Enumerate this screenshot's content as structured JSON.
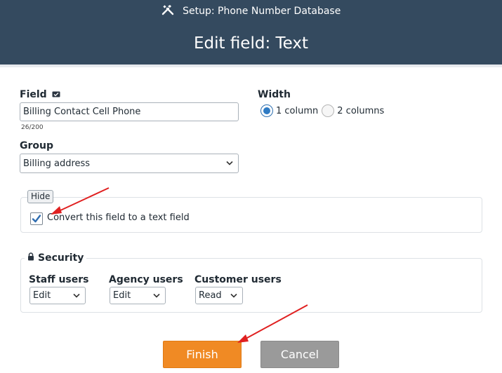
{
  "header": {
    "subtitle": "Setup: Phone Number Database",
    "title": "Edit field: Text"
  },
  "form": {
    "field_label": "Field",
    "field_value": "Billing Contact Cell Phone",
    "field_counter": "26/200",
    "width_label": "Width",
    "width_options": [
      "1 column",
      "2 columns"
    ],
    "width_selected": "1 column",
    "group_label": "Group",
    "group_value": "Billing address"
  },
  "convert_section": {
    "hide_label": "Hide",
    "checkbox_label": "Convert this field to a text field",
    "checked": true
  },
  "security": {
    "legend": "Security",
    "columns": [
      {
        "label": "Staff users",
        "value": "Edit"
      },
      {
        "label": "Agency users",
        "value": "Edit"
      },
      {
        "label": "Customer users",
        "value": "Read"
      }
    ]
  },
  "actions": {
    "finish": "Finish",
    "cancel": "Cancel"
  },
  "colors": {
    "header_bg": "#344a5f",
    "finish_bg": "#f08a24",
    "cancel_bg": "#9a9a9a",
    "annotation_arrow": "#e02020"
  }
}
